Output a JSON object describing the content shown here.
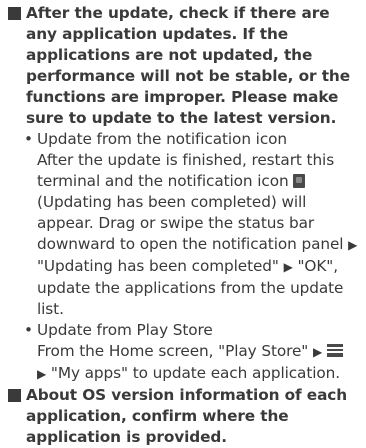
{
  "para1": {
    "text": "After the update, check if there are any application updates. If the applications are not updated, the performance will not be stable, or the functions are improper. Please make sure to update to the latest version."
  },
  "bullets": [
    {
      "title": "Update from the notification icon",
      "line_a": "After the update is finished, restart this terminal and the notification icon",
      "line_b": "(Updating has been completed) will appear. Drag or swipe the status bar downward to open the notification panel",
      "line_c": "\"Updating has been completed\"",
      "line_d": "\"OK\", update the applications from the update list."
    },
    {
      "title": "Update from Play Store",
      "line_a": "From the Home screen, \"Play Store\"",
      "line_b": "\"My apps\" to update each application."
    }
  ],
  "para2": {
    "text": "About OS version information of each application, confirm where the application is provided."
  },
  "glyphs": {
    "bullet": "•",
    "arrow": "▶"
  },
  "icons": {
    "notification": "notification-icon",
    "menu": "menu-icon"
  }
}
